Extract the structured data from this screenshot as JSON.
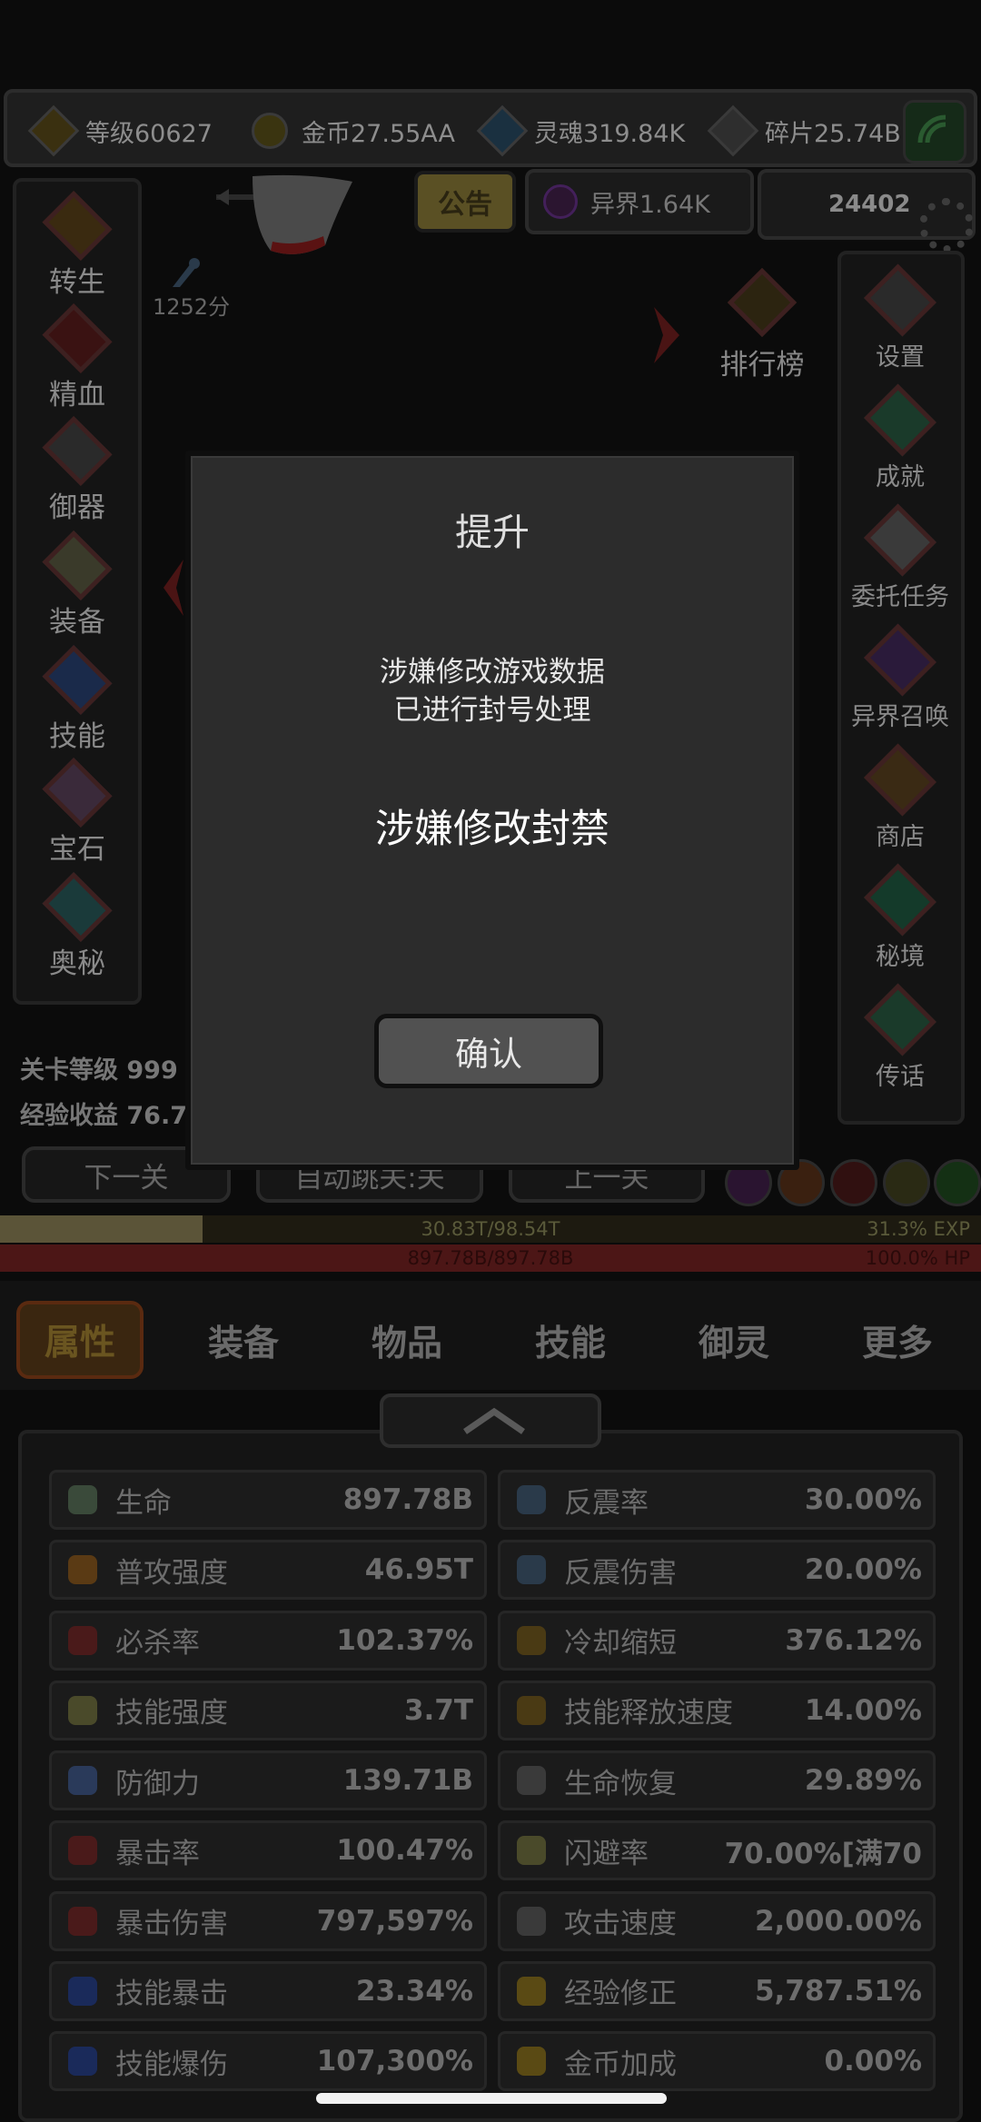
{
  "resources": [
    {
      "label": "等级60627",
      "icon": "crown-icon",
      "color": "#6b5a1a"
    },
    {
      "label": "金币27.55AA",
      "icon": "gold-coin-icon",
      "color": "#5e5420"
    },
    {
      "label": "灵魂319.84K",
      "icon": "soul-icon",
      "color": "#2c4a5a"
    },
    {
      "label": "碎片25.74B",
      "icon": "fragment-icon",
      "color": "#4a4a4a"
    }
  ],
  "top": {
    "notice": "公告",
    "otherworld": "异界1.64K",
    "power": "24402",
    "score": "1252分",
    "rank": "排行榜"
  },
  "left_menu": [
    {
      "label": "转生",
      "icon": "rebirth-icon"
    },
    {
      "label": "精血",
      "icon": "blood-icon"
    },
    {
      "label": "御器",
      "icon": "artifact-icon"
    },
    {
      "label": "装备",
      "icon": "equipment-icon"
    },
    {
      "label": "技能",
      "icon": "skill-icon"
    },
    {
      "label": "宝石",
      "icon": "gem-icon"
    },
    {
      "label": "奥秘",
      "icon": "mystery-icon"
    }
  ],
  "right_menu": [
    {
      "label": "设置",
      "icon": "settings-icon"
    },
    {
      "label": "成就",
      "icon": "achievement-icon"
    },
    {
      "label": "委托任务",
      "icon": "quest-icon"
    },
    {
      "label": "异界召唤",
      "icon": "summon-icon"
    },
    {
      "label": "商店",
      "icon": "shop-icon"
    },
    {
      "label": "秘境",
      "icon": "secret-realm-icon"
    },
    {
      "label": "传话",
      "icon": "message-icon"
    }
  ],
  "stage": {
    "level": "关卡等级 999",
    "exp_gain": "经验收益 76.7",
    "next": "下一关",
    "auto_skip": "自动跳关:关",
    "prev": "上一关"
  },
  "bars": {
    "exp_text": "30.83T/98.54T",
    "exp_pct": "31.3% EXP",
    "exp_fraction": 0.313,
    "hp_text": "897.78B/897.78B",
    "hp_pct": "100.0%  HP",
    "hp_fraction": 1.0
  },
  "tabs": [
    "属性",
    "装备",
    "物品",
    "技能",
    "御灵",
    "更多"
  ],
  "stats_left": [
    {
      "name": "生命",
      "value": "897.78B",
      "color": "#3a4a3a"
    },
    {
      "name": "普攻强度",
      "value": "46.95T",
      "color": "#5a3a14"
    },
    {
      "name": "必杀率",
      "value": "102.37%",
      "color": "#4a1a1a"
    },
    {
      "name": "技能强度",
      "value": "3.7T",
      "color": "#4a4a2a"
    },
    {
      "name": "防御力",
      "value": "139.71B",
      "color": "#2a3a5a"
    },
    {
      "name": "暴击率",
      "value": "100.47%",
      "color": "#4a1a1a"
    },
    {
      "name": "暴击伤害",
      "value": "797,597%",
      "color": "#4a1a1a"
    },
    {
      "name": "技能暴击",
      "value": "23.34%",
      "color": "#1a2a5a"
    },
    {
      "name": "技能爆伤",
      "value": "107,300%",
      "color": "#1a2a5a"
    }
  ],
  "stats_right": [
    {
      "name": "反震率",
      "value": "30.00%",
      "color": "#2a3a4a"
    },
    {
      "name": "反震伤害",
      "value": "20.00%",
      "color": "#2a3a4a"
    },
    {
      "name": "冷却缩短",
      "value": "376.12%",
      "color": "#4a3a14"
    },
    {
      "name": "技能释放速度",
      "value": "14.00%",
      "color": "#4a3a14"
    },
    {
      "name": "生命恢复",
      "value": "29.89%",
      "color": "#3a3a3a"
    },
    {
      "name": "闪避率",
      "value": "70.00%[满70",
      "color": "#4a4a2a"
    },
    {
      "name": "攻击速度",
      "value": "2,000.00%",
      "color": "#3a3a3a"
    },
    {
      "name": "经验修正",
      "value": "5,787.51%",
      "color": "#5a4a14"
    },
    {
      "name": "金币加成",
      "value": "0.00%",
      "color": "#5a4a14"
    }
  ],
  "dialog": {
    "title": "提升",
    "message_line1": "涉嫌修改游戏数据",
    "message_line2": "已进行封号处理",
    "ban_text": "涉嫌修改封禁",
    "confirm": "确认"
  }
}
